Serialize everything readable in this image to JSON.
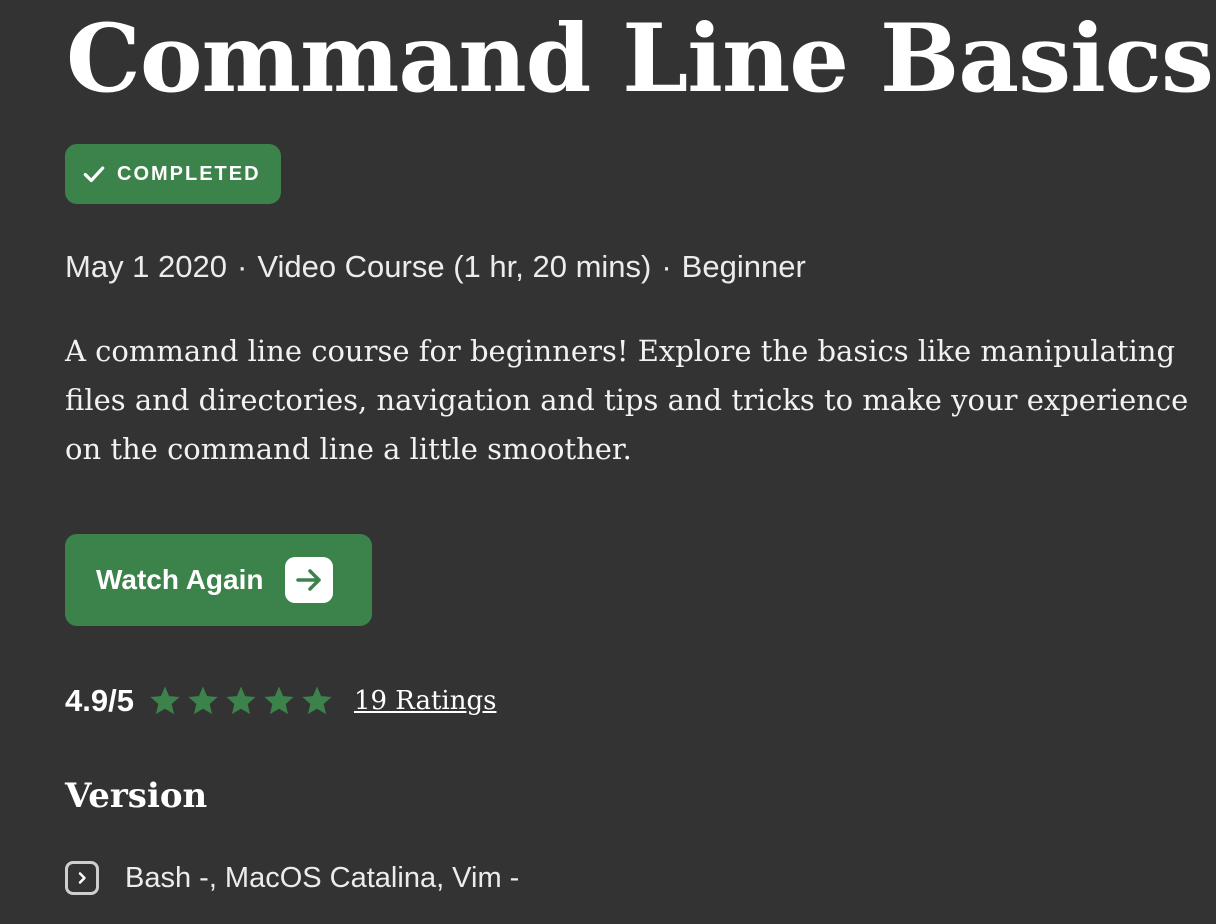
{
  "course": {
    "title": "Command Line Basics",
    "status_badge": "COMPLETED",
    "meta": {
      "date": "May 1 2020",
      "separator": "·",
      "format": "Video Course (1 hr, 20 mins)",
      "level": "Beginner"
    },
    "description": "A command line course for beginners! Explore the basics like manipulating files and directories, navigation and tips and tricks to make your experience on the command line a little smoother.",
    "cta": {
      "label": "Watch Again",
      "icon": "arrow-right-icon"
    }
  },
  "rating": {
    "value_text": "4.9/5",
    "value": 4.9,
    "max": 5,
    "stars_filled": 5,
    "ratings_link": "19 Ratings"
  },
  "version": {
    "heading": "Version",
    "items_text": "Bash -, MacOS Catalina, Vim -",
    "expand_icon": "chevron-right-icon"
  },
  "colors": {
    "background": "#333333",
    "accent_green": "#3b834b",
    "text": "#ffffff"
  }
}
